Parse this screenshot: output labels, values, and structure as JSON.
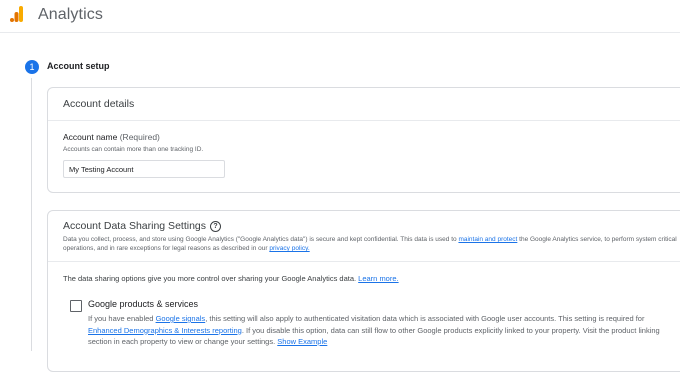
{
  "header": {
    "title": "Analytics"
  },
  "step": {
    "number": "1",
    "label": "Account setup"
  },
  "account_details": {
    "title": "Account details",
    "name_label": "Account name",
    "name_required": "(Required)",
    "name_help": "Accounts can contain more than one tracking ID.",
    "name_value": "My Testing Account"
  },
  "sharing": {
    "title": "Account Data Sharing Settings",
    "desc_1": "Data you collect, process, and store using Google Analytics (\"Google Analytics data\") is secure and kept confidential. This data is used to ",
    "desc_link_1": "maintain and protect",
    "desc_2": " the Google Analytics service, to perform system critical",
    "desc_3": "operations, and in rare exceptions for legal reasons as described in our ",
    "desc_link_2": "privacy policy.",
    "options_intro": "The data sharing options give you more control over sharing your Google Analytics data. ",
    "options_link": "Learn more.",
    "option_1": {
      "title": "Google products & services",
      "line1_a": "If you have enabled ",
      "line1_link": "Google signals",
      "line1_b": ", this setting will also apply to authenticated visitation data which is associated with Google user accounts. This setting is required for",
      "line2_link": "Enhanced Demographics & Interests reporting",
      "line2_b": ". If you disable this option, data can still flow to other Google products explicitly linked to your property. Visit the product linking",
      "line3_a": "section in each property to view or change your settings.  ",
      "line3_link": "Show Example"
    }
  },
  "colors": {
    "accent": "#1a73e8",
    "logo_orange": "#f9ab00",
    "logo_dark": "#e37400"
  }
}
